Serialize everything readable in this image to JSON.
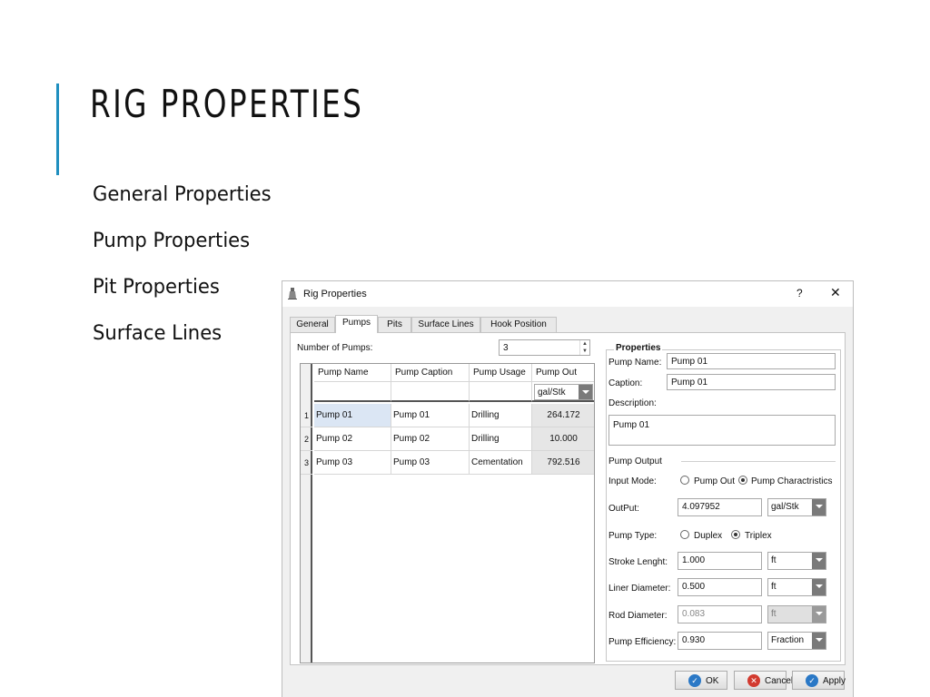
{
  "slide": {
    "title": "RIG PROPERTIES",
    "bullets": [
      "General Properties",
      "Pump Properties",
      "Pit Properties",
      "Surface Lines"
    ],
    "accent_color": "#1f8fbf"
  },
  "dialog": {
    "title": "Rig Properties",
    "app_icon": "rig-icon",
    "help_label": "?",
    "close_label": "✕",
    "tabs": [
      {
        "label": "General",
        "active": false
      },
      {
        "label": "Pumps",
        "active": true
      },
      {
        "label": "Pits",
        "active": false
      },
      {
        "label": "Surface Lines",
        "active": false
      },
      {
        "label": "Hook Position",
        "active": false
      }
    ],
    "pumps": {
      "count_label": "Number of Pumps:",
      "count_value": "3",
      "columns": [
        "Pump Name",
        "Pump Caption",
        "Pump Usage",
        "Pump Out"
      ],
      "pump_out_unit": "gal/Stk",
      "rows": [
        {
          "num": "1",
          "name": "Pump 01",
          "caption": "Pump 01",
          "usage": "Drilling",
          "out": "264.172"
        },
        {
          "num": "2",
          "name": "Pump 02",
          "caption": "Pump 02",
          "usage": "Drilling",
          "out": "10.000"
        },
        {
          "num": "3",
          "name": "Pump 03",
          "caption": "Pump 03",
          "usage": "Cementation",
          "out": "792.516"
        }
      ]
    },
    "properties": {
      "group_label": "Properties",
      "pump_name_label": "Pump Name:",
      "pump_name_value": "Pump 01",
      "caption_label": "Caption:",
      "caption_value": "Pump 01",
      "description_label": "Description:",
      "description_value": "Pump 01",
      "pump_output_label": "Pump Output",
      "input_mode_label": "Input Mode:",
      "input_mode_options": [
        "Pump Out",
        "Pump Charactristics"
      ],
      "input_mode_selected": "Pump Charactristics",
      "output_label": "OutPut:",
      "output_value": "4.097952",
      "output_unit": "gal/Stk",
      "pump_type_label": "Pump Type:",
      "pump_type_options": [
        "Duplex",
        "Triplex"
      ],
      "pump_type_selected": "Triplex",
      "stroke_label": "Stroke Lenght:",
      "stroke_value": "1.000",
      "stroke_unit": "ft",
      "liner_label": "Liner Diameter:",
      "liner_value": "0.500",
      "liner_unit": "ft",
      "rod_label": "Rod Diameter:",
      "rod_value": "0.083",
      "rod_unit": "ft",
      "efficiency_label": "Pump Efficiency:",
      "efficiency_value": "0.930",
      "efficiency_unit": "Fraction"
    },
    "buttons": {
      "ok": "OK",
      "cancel": "Cancel",
      "apply": "Apply",
      "ok_icon_color": "#2a78c6",
      "cancel_icon_color": "#d23a2f",
      "apply_icon_color": "#2a78c6"
    }
  }
}
